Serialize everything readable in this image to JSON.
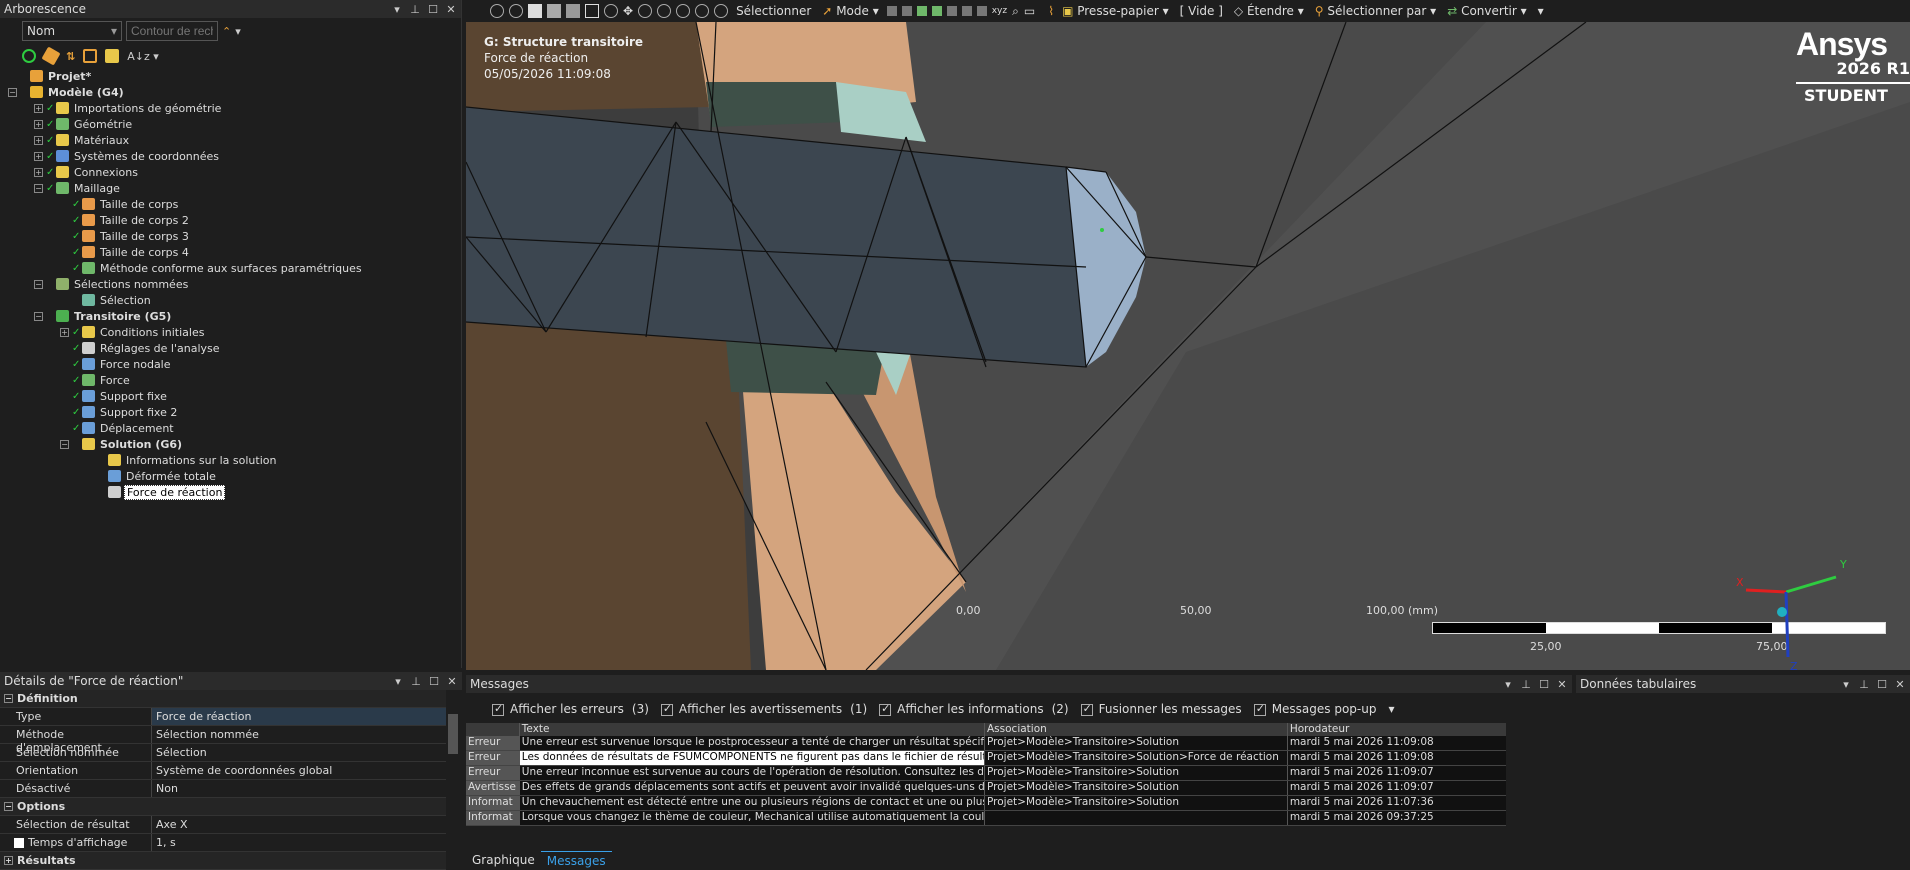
{
  "tree": {
    "title": "Arborescence",
    "filter": {
      "field_value": "Nom",
      "search_placeholder": "Contour de rech"
    },
    "toolbar_icons": [
      "refresh-icon",
      "eraser-icon",
      "sort-icon",
      "grid-icon",
      "folder-icon",
      "sort-az-icon"
    ],
    "items": [
      {
        "label": "Projet*",
        "level": 0,
        "bold": true,
        "expander": "",
        "check": false,
        "icon": "#e8a13a"
      },
      {
        "label": "Modèle (G4)",
        "level": 0,
        "bold": true,
        "expander": "−",
        "check": false,
        "icon": "#e8b330"
      },
      {
        "label": "Importations de géométrie",
        "level": 1,
        "bold": false,
        "expander": "+",
        "check": true,
        "icon": "#e8c84a"
      },
      {
        "label": "Géométrie",
        "level": 1,
        "bold": false,
        "expander": "+",
        "check": true,
        "icon": "#6fb86a"
      },
      {
        "label": "Matériaux",
        "level": 1,
        "bold": false,
        "expander": "+",
        "check": true,
        "icon": "#e8c84a"
      },
      {
        "label": "Systèmes de coordonnées",
        "level": 1,
        "bold": false,
        "expander": "+",
        "check": true,
        "icon": "#5d8fd8"
      },
      {
        "label": "Connexions",
        "level": 1,
        "bold": false,
        "expander": "+",
        "check": true,
        "icon": "#e8c84a"
      },
      {
        "label": "Maillage",
        "level": 1,
        "bold": false,
        "expander": "−",
        "check": true,
        "icon": "#6fb86a"
      },
      {
        "label": "Taille de corps",
        "level": 2,
        "bold": false,
        "expander": "",
        "check": true,
        "icon": "#e89a4a"
      },
      {
        "label": "Taille de corps 2",
        "level": 2,
        "bold": false,
        "expander": "",
        "check": true,
        "icon": "#e89a4a"
      },
      {
        "label": "Taille de corps 3",
        "level": 2,
        "bold": false,
        "expander": "",
        "check": true,
        "icon": "#e89a4a"
      },
      {
        "label": "Taille de corps 4",
        "level": 2,
        "bold": false,
        "expander": "",
        "check": true,
        "icon": "#e89a4a"
      },
      {
        "label": "Méthode conforme aux surfaces paramétriques",
        "level": 2,
        "bold": false,
        "expander": "",
        "check": true,
        "icon": "#6fb86a"
      },
      {
        "label": "Sélections nommées",
        "level": 1,
        "bold": false,
        "expander": "−",
        "check": false,
        "icon": "#8fb06a"
      },
      {
        "label": "Sélection",
        "level": 2,
        "bold": false,
        "expander": "",
        "check": false,
        "icon": "#6fb8a0"
      },
      {
        "label": "Transitoire (G5)",
        "level": 1,
        "bold": true,
        "expander": "−",
        "check": false,
        "icon": "#4caf50"
      },
      {
        "label": "Conditions initiales",
        "level": 2,
        "bold": false,
        "expander": "+",
        "check": true,
        "icon": "#e8c84a"
      },
      {
        "label": "Réglages de l'analyse",
        "level": 2,
        "bold": false,
        "expander": "",
        "check": true,
        "icon": "#cfcfcf"
      },
      {
        "label": "Force nodale",
        "level": 2,
        "bold": false,
        "expander": "",
        "check": true,
        "icon": "#6a9ed8"
      },
      {
        "label": "Force",
        "level": 2,
        "bold": false,
        "expander": "",
        "check": true,
        "icon": "#6fb86a"
      },
      {
        "label": "Support fixe",
        "level": 2,
        "bold": false,
        "expander": "",
        "check": true,
        "icon": "#6a9ed8"
      },
      {
        "label": "Support fixe 2",
        "level": 2,
        "bold": false,
        "expander": "",
        "check": true,
        "icon": "#6a9ed8"
      },
      {
        "label": "Déplacement",
        "level": 2,
        "bold": false,
        "expander": "",
        "check": true,
        "icon": "#6a9ed8"
      },
      {
        "label": "Solution (G6)",
        "level": 2,
        "bold": true,
        "expander": "−",
        "check": false,
        "icon": "#e8c84a"
      },
      {
        "label": "Informations sur la solution",
        "level": 3,
        "bold": false,
        "expander": "",
        "check": false,
        "icon": "#e8c84a"
      },
      {
        "label": "Déformée totale",
        "level": 3,
        "bold": false,
        "expander": "",
        "check": false,
        "icon": "#6a9ed8"
      },
      {
        "label": "Force de réaction",
        "level": 3,
        "bold": false,
        "expander": "",
        "check": false,
        "icon": "#cfcfcf",
        "selected": true
      }
    ]
  },
  "details": {
    "title": "Détails de \"Force de réaction\"",
    "sections": [
      {
        "name": "Définition",
        "rows": [
          {
            "k": "Type",
            "v": "Force de réaction",
            "sel": true
          },
          {
            "k": "Méthode d'emplacement",
            "v": "Sélection nommée"
          },
          {
            "k": "Sélection nommée",
            "v": "Sélection"
          },
          {
            "k": "Orientation",
            "v": "Système de coordonnées global"
          },
          {
            "k": "Désactivé",
            "v": "Non"
          }
        ]
      },
      {
        "name": "Options",
        "rows": [
          {
            "k": "Sélection de résultat",
            "v": "Axe X"
          },
          {
            "k": "Temps d'affichage",
            "v": "1, s",
            "checkbox": true
          }
        ]
      },
      {
        "name": "Résultats",
        "rows": []
      }
    ]
  },
  "toolbar": {
    "select_label": "Sélectionner",
    "mode_label": "Mode",
    "clipboard_label": "Presse-papier",
    "empty_label": "[ Vide ]",
    "extend_label": "Étendre",
    "select_by_label": "Sélectionner par",
    "convert_label": "Convertir"
  },
  "viewport": {
    "title": "G: Structure transitoire",
    "subtitle": "Force de réaction",
    "timestamp": "05/05/2026 11:09:08",
    "brand": "Ansys",
    "version": "2026 R1",
    "edition": "STUDENT",
    "scale_top": [
      "0,00",
      "50,00",
      "100,00 (mm)"
    ],
    "scale_bottom": [
      "25,00",
      "75,00"
    ],
    "triad": {
      "x": "X",
      "y": "Y",
      "z": "Z"
    }
  },
  "messages": {
    "title": "Messages",
    "options": [
      {
        "label": "Afficher les erreurs",
        "count": "(3)"
      },
      {
        "label": "Afficher les avertissements",
        "count": "(1)"
      },
      {
        "label": "Afficher les informations",
        "count": "(2)"
      },
      {
        "label": "Fusionner les messages",
        "count": ""
      },
      {
        "label": "Messages pop-up",
        "count": ""
      }
    ],
    "columns": [
      "",
      "Texte",
      "Association",
      "Horodateur"
    ],
    "rows": [
      [
        "Erreur",
        "Une erreur est survenue lorsque le postprocesseur a tenté de charger un résultat spécifique",
        "Projet>Modèle>Transitoire>Solution",
        "mardi 5 mai 2026 11:09:08"
      ],
      [
        "Erreur",
        "Les données de résultats de FSUMCOMPONENTS ne figurent pas dans le fichier de résultats",
        "Projet>Modèle>Transitoire>Solution>Force de réaction",
        "mardi 5 mai 2026 11:09:08"
      ],
      [
        "Erreur",
        "Une erreur inconnue est survenue au cours de l'opération de résolution. Consultez les do",
        "Projet>Modèle>Transitoire>Solution",
        "mardi 5 mai 2026 11:09:07"
      ],
      [
        "Avertisse",
        "Des effets de grands déplacements sont actifs et peuvent avoir invalidé quelques-uns des",
        "Projet>Modèle>Transitoire>Solution",
        "mardi 5 mai 2026 11:09:07"
      ],
      [
        "Informat",
        "Un chevauchement est détecté entre une ou plusieurs régions de contact et une ou plusieurs",
        "Projet>Modèle>Transitoire>Solution",
        "mardi 5 mai 2026 11:07:36"
      ],
      [
        "Informat",
        "Lorsque vous changez le thème de couleur, Mechanical utilise automatiquement la couleur",
        "",
        "mardi 5 mai 2026 09:37:25"
      ]
    ],
    "tabs": [
      "Graphique",
      "Messages"
    ]
  },
  "tabular": {
    "title": "Données tabulaires"
  }
}
